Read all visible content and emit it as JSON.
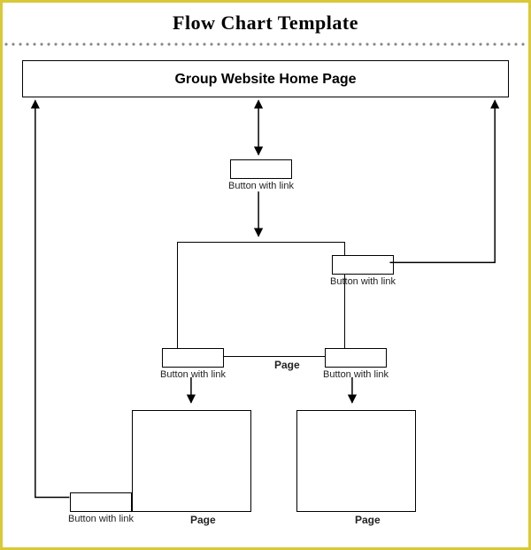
{
  "title": "Flow Chart Template",
  "header_box": "Group Website Home Page",
  "labels": {
    "button_link_1": "Button with link",
    "button_link_right_top": "Button with link",
    "page_center": "Page",
    "button_link_left_mid": "Button with link",
    "button_link_right_mid": "Button with link",
    "page_left_bottom": "Page",
    "page_right_bottom": "Page",
    "button_link_bottom_left": "Button with link"
  },
  "chart_data": {
    "type": "flowchart",
    "nodes": [
      {
        "id": "home",
        "label": "Group Website Home Page",
        "shape": "rect"
      },
      {
        "id": "btn1",
        "label": "Button with link",
        "shape": "rect"
      },
      {
        "id": "pageCenter",
        "label": "Page",
        "shape": "rect"
      },
      {
        "id": "btnRightTop",
        "label": "Button with link",
        "shape": "rect"
      },
      {
        "id": "btnLeftMid",
        "label": "Button with link",
        "shape": "rect"
      },
      {
        "id": "btnRightMid",
        "label": "Button with link",
        "shape": "rect"
      },
      {
        "id": "pageLeft",
        "label": "Page",
        "shape": "rect"
      },
      {
        "id": "pageRight",
        "label": "Page",
        "shape": "rect"
      },
      {
        "id": "btnBottomLeft",
        "label": "Button with link",
        "shape": "rect"
      }
    ],
    "edges": [
      {
        "from": "home",
        "to": "btn1",
        "bidirectional": true
      },
      {
        "from": "btn1",
        "to": "pageCenter"
      },
      {
        "from": "pageCenter",
        "to": "btnRightTop",
        "via": "right"
      },
      {
        "from": "btnRightTop",
        "to": "home",
        "via": "right-side"
      },
      {
        "from": "pageCenter",
        "to": "btnLeftMid",
        "via": "bottom-left"
      },
      {
        "from": "pageCenter",
        "to": "btnRightMid",
        "via": "bottom-right"
      },
      {
        "from": "btnLeftMid",
        "to": "pageLeft"
      },
      {
        "from": "btnRightMid",
        "to": "pageRight"
      },
      {
        "from": "pageLeft",
        "to": "btnBottomLeft"
      },
      {
        "from": "btnBottomLeft",
        "to": "home",
        "via": "left-side"
      }
    ]
  }
}
